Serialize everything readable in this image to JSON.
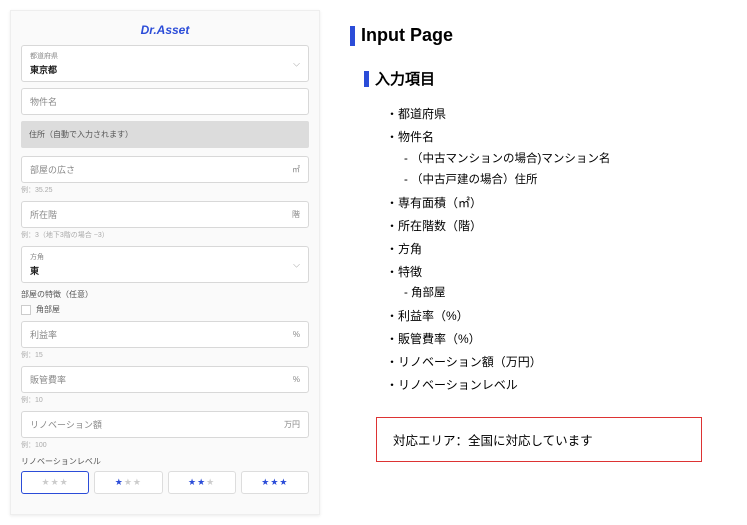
{
  "logo": "Dr.Asset",
  "form": {
    "prefecture": {
      "label": "都道府県",
      "value": "東京都"
    },
    "property_name": {
      "placeholder": "物件名"
    },
    "address_block": "住所（自動で入力されます）",
    "area": {
      "placeholder": "部屋の広さ",
      "unit": "㎡",
      "hint": "例：35.25"
    },
    "floor": {
      "placeholder": "所在階",
      "unit": "階",
      "hint": "例：3（地下3階の場合 −3）"
    },
    "direction": {
      "label": "方角",
      "value": "東"
    },
    "features_label": "部屋の特徴（任意）",
    "corner_room": "角部屋",
    "profit_rate": {
      "placeholder": "利益率",
      "unit": "%",
      "hint": "例：15"
    },
    "mgmt_rate": {
      "placeholder": "販管費率",
      "unit": "%",
      "hint": "例：10"
    },
    "renovation": {
      "placeholder": "リノベーション額",
      "unit": "万円",
      "hint": "例：100"
    },
    "reno_level_label": "リノベーションレベル"
  },
  "right": {
    "title": "Input Page",
    "subtitle": "入力項目",
    "items": [
      "都道府県",
      "物件名",
      "専有面積（㎡）",
      "所在階数（階）",
      "方角",
      "特徴",
      "利益率（%）",
      "販管費率（%）",
      "リノベーション額（万円）",
      "リノベーションレベル"
    ],
    "sub_property": [
      "（中古マンションの場合)マンション名",
      "（中古戸建の場合）住所"
    ],
    "sub_feature": [
      "角部屋"
    ],
    "callout": "対応エリア：全国に対応しています"
  }
}
